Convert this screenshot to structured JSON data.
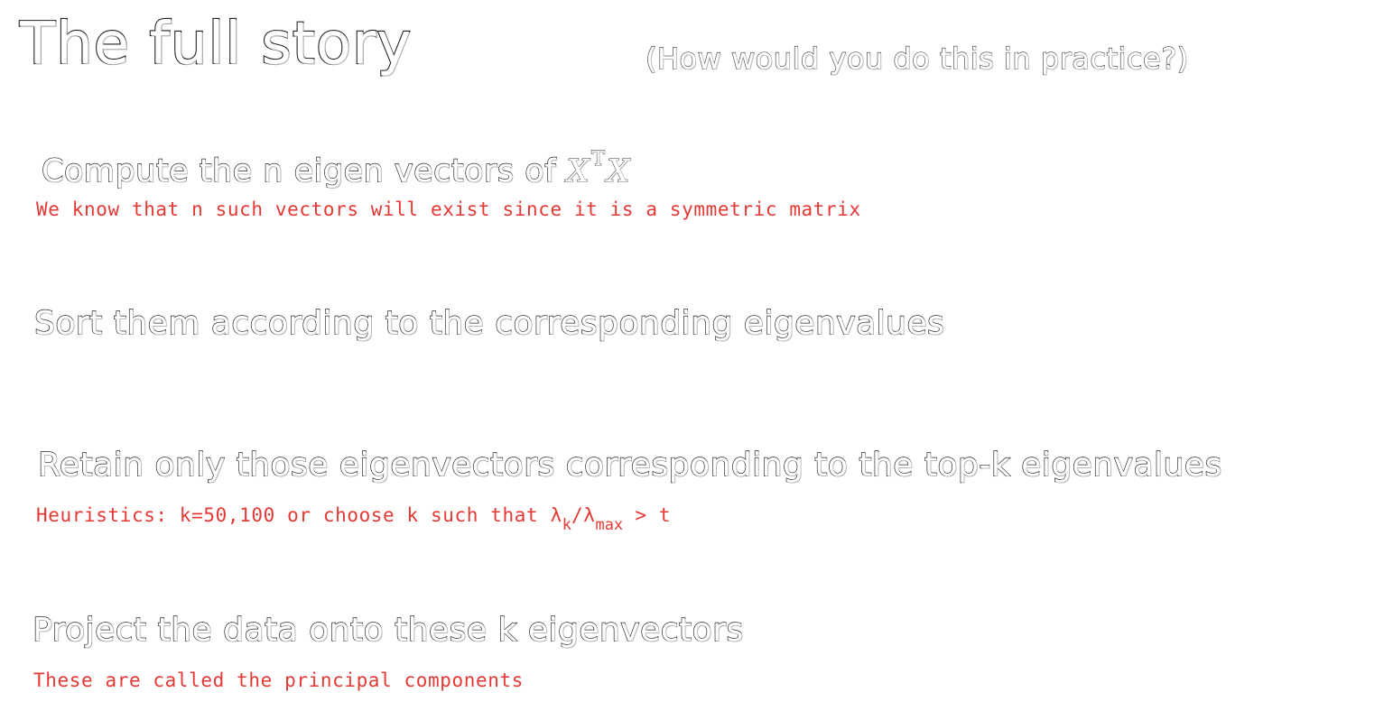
{
  "slide": {
    "title": "The full story",
    "subtitle": "(How would you do this in practice?)"
  },
  "steps": [
    {
      "text": "Compute the n eigen vectors of ",
      "math_base": "X",
      "math_sup": "T",
      "math_tail": "X",
      "note": "We know that n such vectors will exist since it is a symmetric matrix"
    },
    {
      "text": "Sort them according to the corresponding eigenvalues"
    },
    {
      "text": "Retain only those eigenvectors corresponding to the top-k eigenvalues",
      "note_prefix": "Heuristics: k=50,100 or choose k such that ",
      "note_lambda1": "λ",
      "note_sub1": "k",
      "note_slash": "/",
      "note_lambda2": "λ",
      "note_sub2": "max",
      "note_suffix": " > t"
    },
    {
      "text": "Project the data onto these k eigenvectors",
      "note": "These are called the principal components"
    }
  ],
  "colors": {
    "note": "#e53935",
    "text_outline": "#2b2b2b",
    "background": "#ffffff"
  }
}
